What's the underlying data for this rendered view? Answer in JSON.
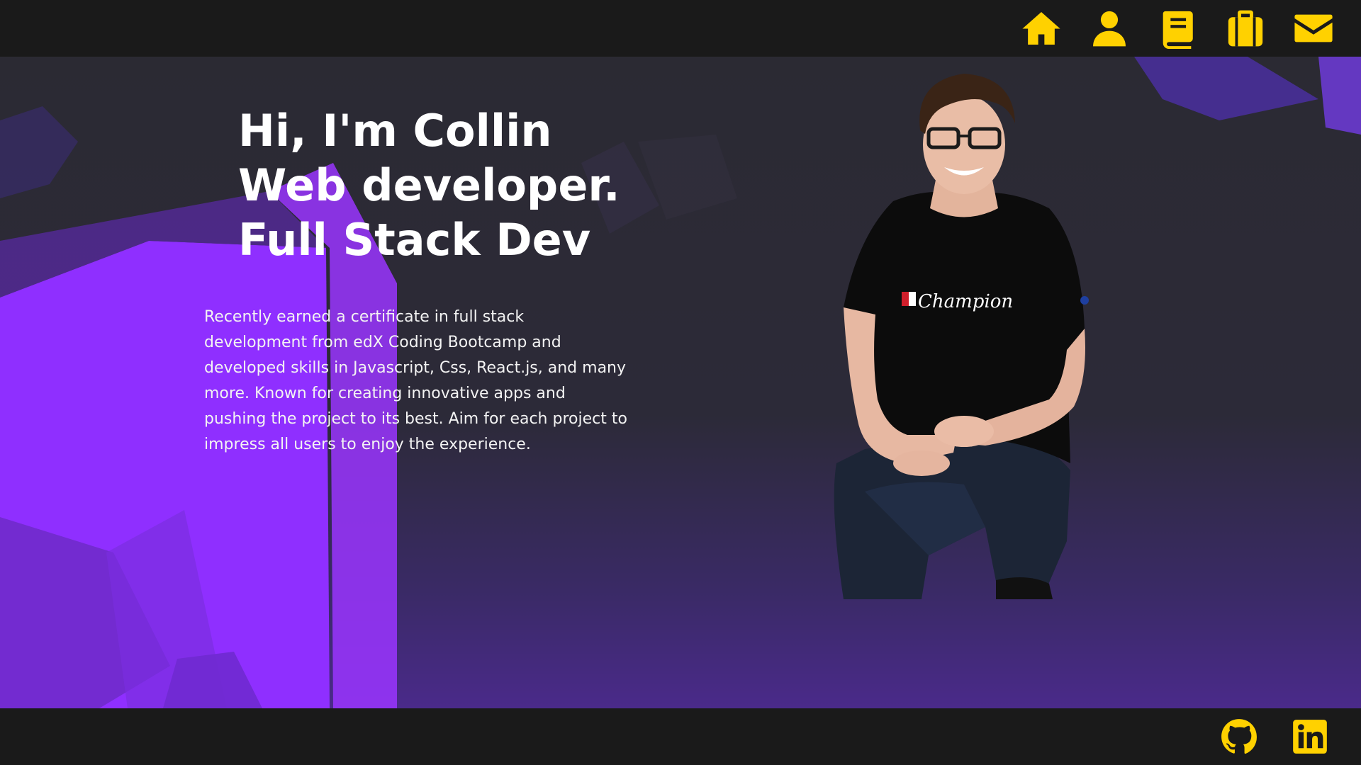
{
  "theme": {
    "accent": "#ffd100",
    "header_bg": "#1a1a1a",
    "hero_purple": "#8f2fff",
    "hero_dark": "#2b2a33"
  },
  "nav": {
    "items": [
      {
        "icon": "home-icon"
      },
      {
        "icon": "user-icon"
      },
      {
        "icon": "book-icon"
      },
      {
        "icon": "briefcase-icon"
      },
      {
        "icon": "envelope-icon"
      }
    ]
  },
  "hero": {
    "headline": [
      "Hi, I'm Collin",
      "Web developer.",
      "Full Stack Dev"
    ],
    "bio": "Recently earned a certificate in full stack development from edX Coding Bootcamp and developed skills in Javascript, Css, React.js, and many more. Known for creating innovative apps and pushing the project to its best. Aim for each project to impress all users to enjoy the experience.",
    "photo": {
      "shirt_text": "Champion"
    }
  },
  "footer": {
    "social": [
      {
        "icon": "github-icon"
      },
      {
        "icon": "linkedin-icon"
      }
    ]
  }
}
